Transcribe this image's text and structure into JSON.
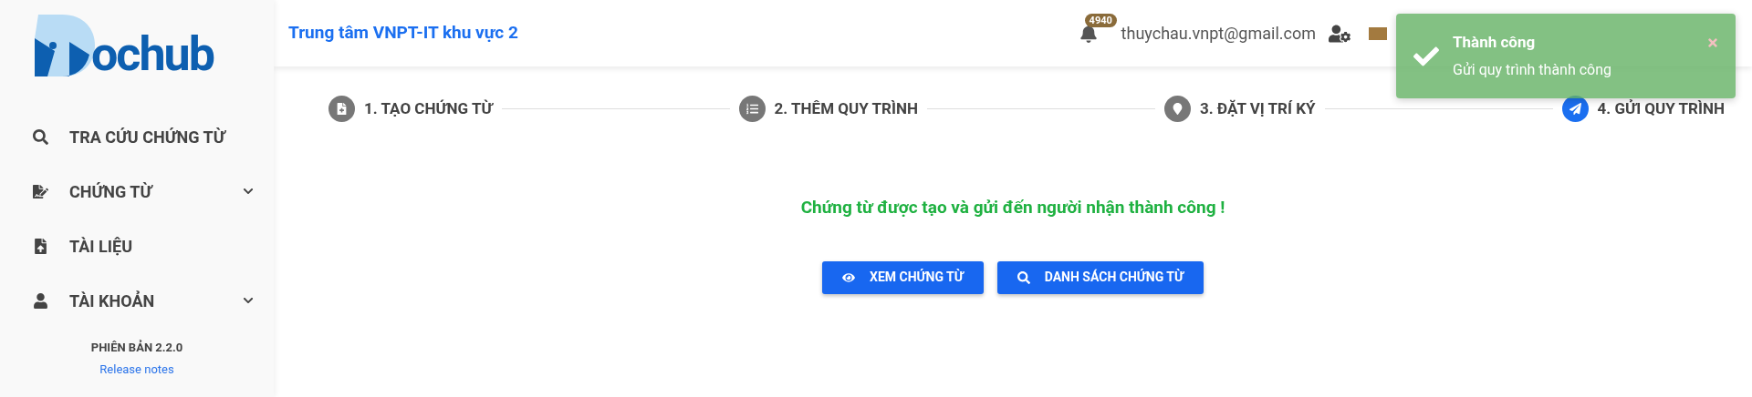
{
  "sidebar": {
    "logo_text": "ochub",
    "items": [
      {
        "label": "TRA CỨU CHỨNG TỪ",
        "expandable": false
      },
      {
        "label": "CHỨNG TỪ",
        "expandable": true
      },
      {
        "label": "TÀI LIỆU",
        "expandable": false
      },
      {
        "label": "TÀI KHOẢN",
        "expandable": true
      }
    ],
    "version": "PHIÊN BẢN 2.2.0",
    "release_notes": "Release notes"
  },
  "header": {
    "title": "Trung tâm VNPT-IT khu vực 2",
    "notification_count": "4940",
    "email": "thuychau.vnpt@gmail.com"
  },
  "steps": [
    {
      "label": "1. TẠO CHỨNG TỪ",
      "selected": false
    },
    {
      "label": "2. THÊM QUY TRÌNH",
      "selected": false
    },
    {
      "label": "3. ĐẶT VỊ TRÍ KÝ",
      "selected": false
    },
    {
      "label": "4. GỬI QUY TRÌNH",
      "selected": true
    }
  ],
  "message": "Chứng từ được tạo và gửi đến người nhận thành công !",
  "buttons": [
    {
      "label": "XEM CHỨNG TỪ"
    },
    {
      "label": "DANH SÁCH CHỨNG TỪ"
    }
  ],
  "toast": {
    "title": "Thành công",
    "text": "Gửi quy trình thành công"
  }
}
